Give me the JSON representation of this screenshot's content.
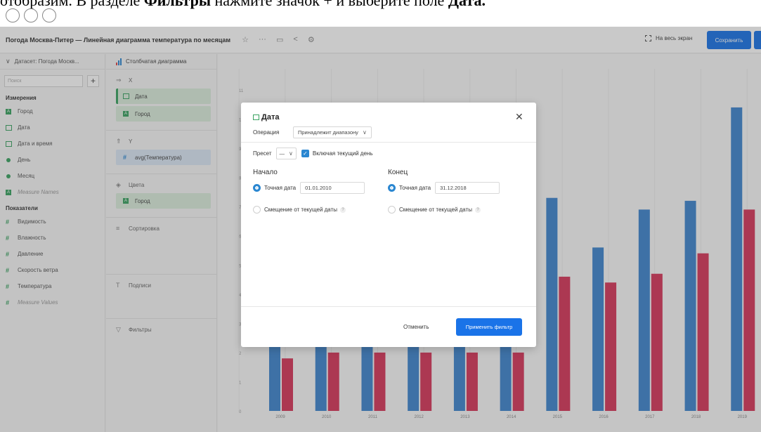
{
  "caption": {
    "prefix": "отобразим. В разделе ",
    "bold1": "Фильтры",
    "middle": " нажмите значок + и выберите поле ",
    "bold2": "Дата."
  },
  "header": {
    "title": "Погода Москва-Питер — Линейная диаграмма температура по месяцам",
    "fullscreen_label": "На весь экран",
    "save_label": "Сохранить"
  },
  "dataset_panel": {
    "dataset_label": "Датасет: Погода Москв...",
    "search_placeholder": "Поиск",
    "dimensions_title": "Измерения",
    "dimensions": [
      {
        "label": "Город",
        "icon": "abc-icon"
      },
      {
        "label": "Дата",
        "icon": "calendar-icon"
      },
      {
        "label": "Дата и время",
        "icon": "calendar-icon"
      },
      {
        "label": "День",
        "icon": "dot-icon"
      },
      {
        "label": "Месяц",
        "icon": "dot-icon"
      },
      {
        "label": "Measure Names",
        "icon": "abc-icon"
      }
    ],
    "measures_title": "Показатели",
    "measures": [
      {
        "label": "Видимость"
      },
      {
        "label": "Влажность"
      },
      {
        "label": "Давление"
      },
      {
        "label": "Скорость ветра"
      },
      {
        "label": "Температура"
      },
      {
        "label": "Measure Values"
      }
    ]
  },
  "wizard": {
    "chart_type": "Столбчатая диаграмма",
    "x_label": "X",
    "x_fields": [
      "Дата",
      "Город"
    ],
    "y_label": "Y",
    "y_field": "avg(Температура)",
    "colors_label": "Цвета",
    "colors_field": "Город",
    "sort_label": "Сортировка",
    "labels_label": "Подписи",
    "filters_label": "Фильтры"
  },
  "modal": {
    "title": "Дата",
    "operation_label": "Операция",
    "operation_value": "Принадлежит диапазону",
    "preset_label": "Пресет",
    "preset_value": "—",
    "include_today_label": "Включая текущий день",
    "start_title": "Начало",
    "end_title": "Конец",
    "exact_date_label": "Точная дата",
    "start_date": "01.01.2010",
    "end_date": "31.12.2018",
    "offset_label": "Смещение от текущей даты",
    "cancel_label": "Отменить",
    "apply_label": "Применить фильтр"
  },
  "colors": {
    "accent": "#1a73e8",
    "series_blue": "#3f86cf",
    "series_red": "#d7365a",
    "green": "#3aa361"
  },
  "chart_data": {
    "type": "bar",
    "categories": [
      "2009",
      "2010",
      "2011",
      "2012",
      "2013",
      "2014",
      "2015",
      "2016",
      "2017",
      "2018",
      "2019"
    ],
    "series": [
      {
        "values": [
          4.5,
          4.8,
          4.6,
          4.5,
          4.7,
          4.6,
          7.3,
          5.6,
          6.9,
          7.2,
          10.4
        ]
      },
      {
        "values": [
          1.8,
          2.0,
          2.0,
          2.0,
          2.0,
          2.0,
          4.6,
          4.4,
          4.7,
          5.4,
          6.9
        ]
      }
    ],
    "yticks": [
      "0",
      "1",
      "2",
      "3",
      "4",
      "5",
      "6",
      "7",
      "8",
      "9",
      "10",
      "11"
    ],
    "ylim": [
      0,
      11
    ]
  }
}
